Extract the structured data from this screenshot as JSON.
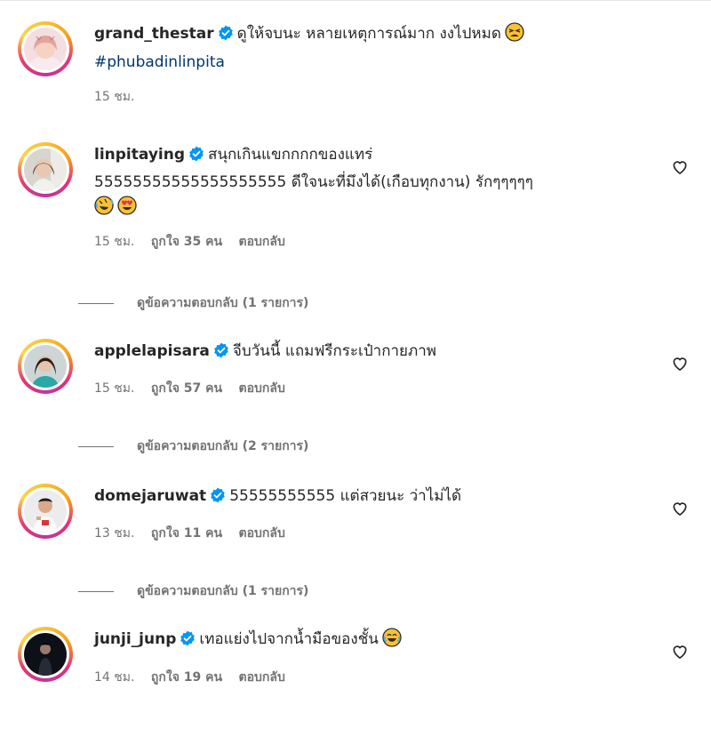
{
  "comments": [
    {
      "username": "grand_thestar",
      "text_line1": "ดูให้จบนะ หลายเหตุการณ์มาก งงไปหมด",
      "hashtag": "#phubadinlinpita",
      "time": "15 ชม.",
      "emoji_icons": [
        "tired-face-icon"
      ]
    },
    {
      "username": "linpitaying",
      "text_line1": "สนุกเกินแขกกกกของแทร่",
      "text_line2": "55555555555555555555 ดีใจนะที่มึงได้(เกือบทุกงาน) รักๆๆๆๆๆ",
      "time": "15 ชม.",
      "likes": "ถูกใจ 35 คน",
      "reply": "ตอบกลับ",
      "view_replies": "ดูข้อความตอบกลับ (1 รายการ)",
      "emoji_icons": [
        "rofl-icon",
        "heart-eyes-icon"
      ]
    },
    {
      "username": "applelapisara",
      "text_line1": "จีบวันนี้ แถมฟรีกระเป๋ากายภาพ",
      "time": "15 ชม.",
      "likes": "ถูกใจ 57 คน",
      "reply": "ตอบกลับ",
      "view_replies": "ดูข้อความตอบกลับ (2 รายการ)"
    },
    {
      "username": "domejaruwat",
      "text_line1": "55555555555 แต่สวยนะ ว่าไม่ได้",
      "time": "13 ชม.",
      "likes": "ถูกใจ 11 คน",
      "reply": "ตอบกลับ",
      "view_replies": "ดูข้อความตอบกลับ (1 รายการ)"
    },
    {
      "username": "junji_junp",
      "text_line1": "เทอแย่งไปจากน้ำมือของชั้น",
      "time": "14 ชม.",
      "likes": "ถูกใจ 19 คน",
      "reply": "ตอบกลับ",
      "emoji_icons": [
        "tears-of-joy-icon"
      ]
    }
  ],
  "colors": {
    "verified": "#0095f6",
    "hashtag": "#00376b",
    "meta": "#737373",
    "text": "#262626"
  }
}
